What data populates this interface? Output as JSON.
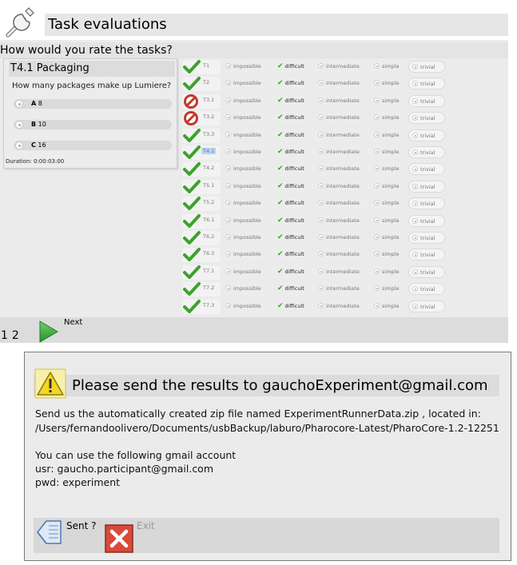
{
  "window": {
    "title": "Task evaluations",
    "question": "How would you rate the tasks?"
  },
  "task_preview": {
    "title": "T4.1 Packaging",
    "question": "How many packages make up Lumiere?",
    "answers": [
      {
        "letter": "A",
        "value": "8"
      },
      {
        "letter": "B",
        "value": "10"
      },
      {
        "letter": "C",
        "value": "16"
      }
    ],
    "duration": "Duration: 0:00:03:00"
  },
  "rating_options": [
    "impossible",
    "difficult",
    "intermediate",
    "simple",
    "trivial"
  ],
  "ratings": [
    {
      "id": "T1",
      "status": "check",
      "selected": "difficult"
    },
    {
      "id": "T2",
      "status": "check",
      "selected": "difficult"
    },
    {
      "id": "T3.1",
      "status": "forbidden",
      "selected": "difficult"
    },
    {
      "id": "T3.2",
      "status": "forbidden",
      "selected": "difficult"
    },
    {
      "id": "T3.3",
      "status": "check",
      "selected": "difficult"
    },
    {
      "id": "T4.1",
      "status": "check",
      "selected": "difficult",
      "highlighted": true
    },
    {
      "id": "T4.2",
      "status": "check",
      "selected": "difficult"
    },
    {
      "id": "T5.1",
      "status": "check",
      "selected": "difficult"
    },
    {
      "id": "T5.2",
      "status": "check",
      "selected": "difficult"
    },
    {
      "id": "T6.1",
      "status": "check",
      "selected": "difficult"
    },
    {
      "id": "T6.2",
      "status": "check",
      "selected": "difficult"
    },
    {
      "id": "T6.3",
      "status": "check",
      "selected": "difficult"
    },
    {
      "id": "T7.1",
      "status": "check",
      "selected": "difficult"
    },
    {
      "id": "T7.2",
      "status": "check",
      "selected": "difficult"
    },
    {
      "id": "T7.3",
      "status": "check",
      "selected": "difficult"
    }
  ],
  "pager": {
    "pages": [
      "1",
      "2"
    ],
    "next_label": "Next"
  },
  "dialog": {
    "title": "Please send the results to gauchoExperiment@gmail.com",
    "line1": "Send us the automatically created zip file named ExperimentRunnerData.zip , located in:",
    "line2": "/Users/fernandoolivero/Documents/usbBackup/laburo/Pharocore-Latest/PharoCore-1.2-12251",
    "line3": "You can use the following gmail account",
    "line4": "usr: gaucho.participant@gmail.com",
    "line5": "pwd: experiment",
    "sent_label": "Sent ?",
    "exit_label": "Exit"
  },
  "colors": {
    "check_green": "#3da22c",
    "forbidden_red": "#c0392b",
    "next_arrow_green": "#3aa43a",
    "warning_yellow": "#f5d623"
  },
  "icons": {
    "title": "wrench-icon",
    "status_ok": "checkmark-icon",
    "status_blocked": "forbidden-icon",
    "next": "next-arrow-icon",
    "dialog": "warning-icon",
    "sent": "book-icon",
    "exit": "close-icon"
  }
}
